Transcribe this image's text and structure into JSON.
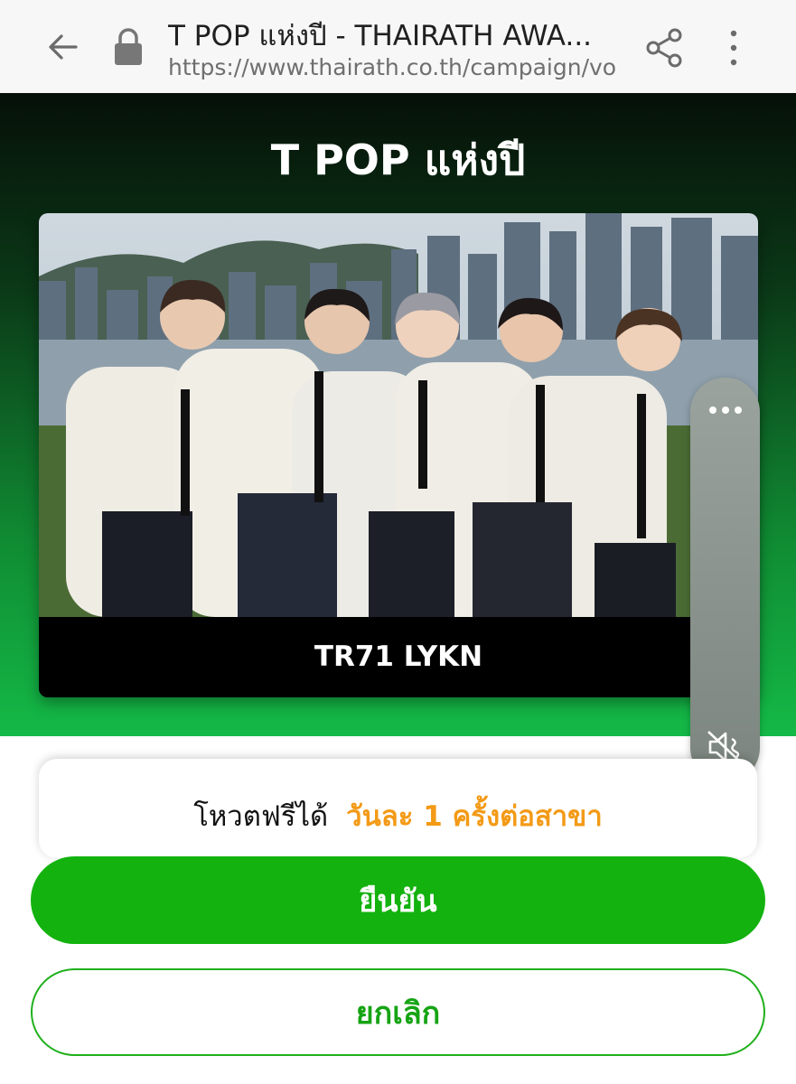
{
  "browser": {
    "title": "T POP แห่งปี - THAIRATH AWA...",
    "url": "https://www.thairath.co.th/campaign/vo",
    "icons": {
      "back": "arrow-left-icon",
      "secure": "lock-icon",
      "share": "share-icon",
      "menu": "more-vert-icon"
    }
  },
  "hero": {
    "title": "T POP แห่งปี",
    "candidate_name": "TR71 LYKN"
  },
  "video_widget": {
    "icons": {
      "options": "more-horiz-icon",
      "sound": "volume-muted-icon"
    }
  },
  "vote_info": {
    "prefix": "โหวตฟรีได้",
    "highlight": "วันละ 1 ครั้งต่อสาขา"
  },
  "actions": {
    "confirm_label": "ยืนยัน",
    "cancel_label": "ยกเลิก"
  },
  "colors": {
    "primary_green": "#13b20f",
    "accent_orange": "#f39a16"
  }
}
